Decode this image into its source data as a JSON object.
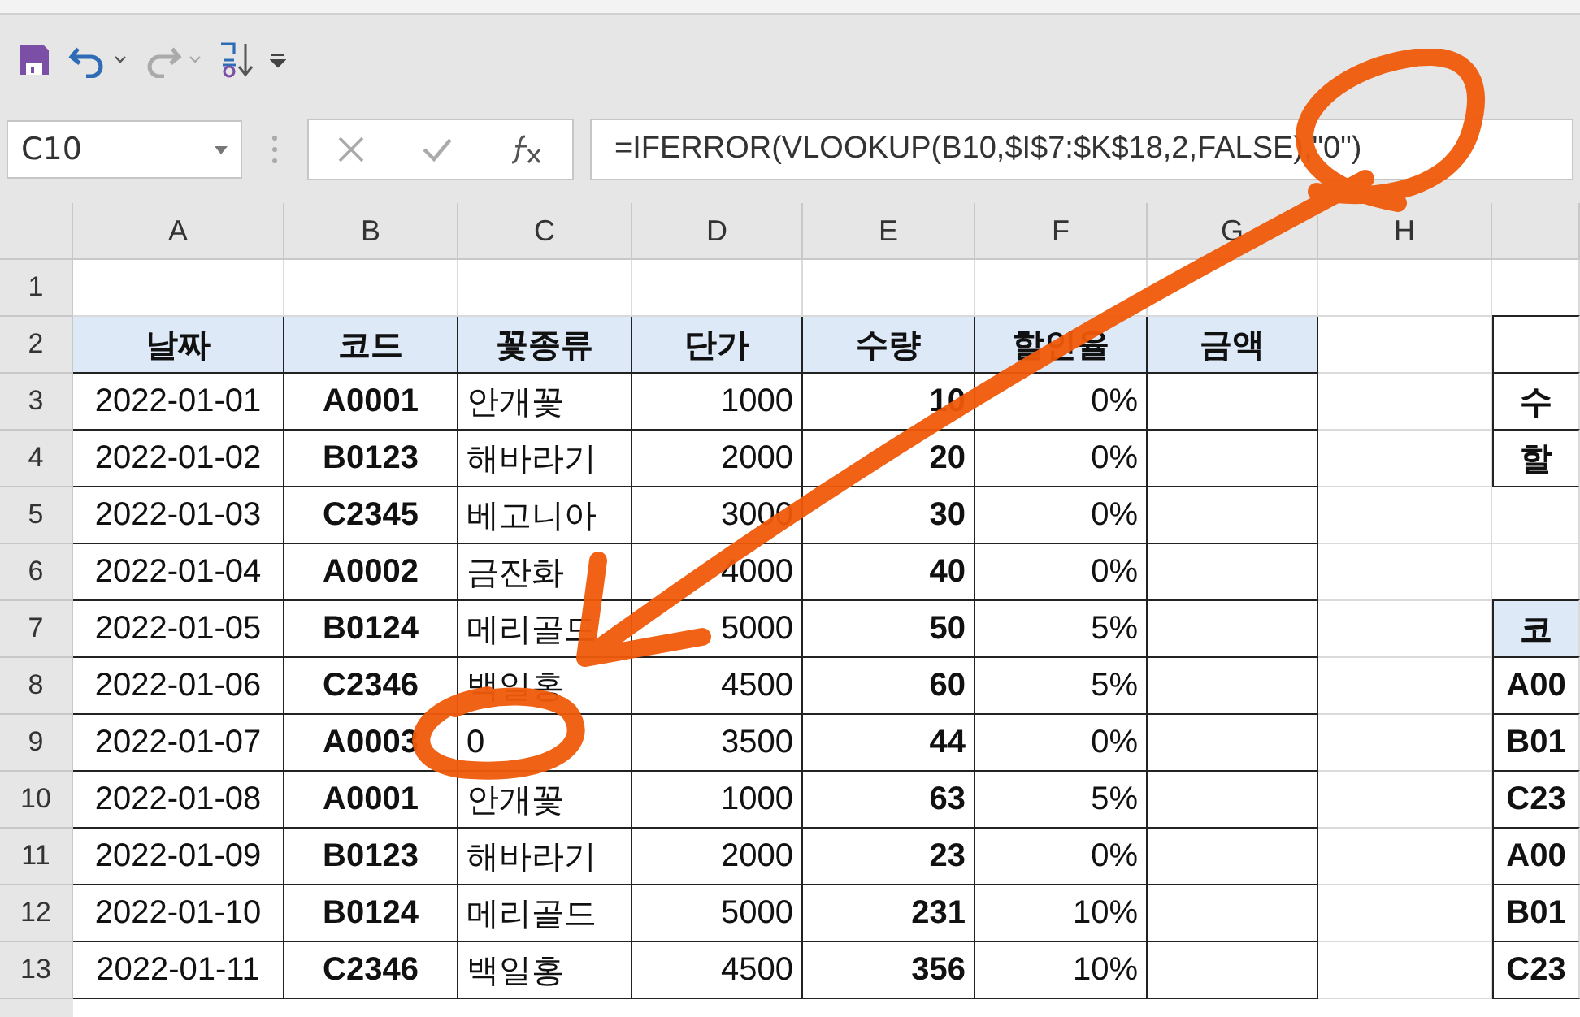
{
  "name_box": {
    "value": "C10"
  },
  "formula_bar": {
    "value": "=IFERROR(VLOOKUP(B10,$I$7:$K$18,2,FALSE),\"0\")"
  },
  "columns": [
    "A",
    "B",
    "C",
    "D",
    "E",
    "F",
    "G",
    "H"
  ],
  "first_row": {
    "number": "1"
  },
  "header_row": {
    "number": "2",
    "labels": [
      "날짜",
      "코드",
      "꽃종류",
      "단가",
      "수량",
      "할인율",
      "금액"
    ],
    "column_i": {
      "kind": "cell"
    }
  },
  "rows": [
    {
      "number": "3",
      "date": "2022-01-01",
      "code": "A0001",
      "flower": "안개꽃",
      "price": "1000",
      "qty": "10",
      "discount": "0%",
      "column_i": {
        "kind": "cell",
        "text": "수"
      }
    },
    {
      "number": "4",
      "date": "2022-01-02",
      "code": "B0123",
      "flower": "해바라기",
      "price": "2000",
      "qty": "20",
      "discount": "0%",
      "column_i": {
        "kind": "cell",
        "text": "할"
      }
    },
    {
      "number": "5",
      "date": "2022-01-03",
      "code": "C2345",
      "flower": "베고니아",
      "price": "3000",
      "qty": "30",
      "discount": "0%"
    },
    {
      "number": "6",
      "date": "2022-01-04",
      "code": "A0002",
      "flower": "금잔화",
      "price": "4000",
      "qty": "40",
      "discount": "0%"
    },
    {
      "number": "7",
      "date": "2022-01-05",
      "code": "B0124",
      "flower": "메리골드",
      "price": "5000",
      "qty": "50",
      "discount": "5%",
      "column_i": {
        "kind": "header",
        "text": "코"
      }
    },
    {
      "number": "8",
      "date": "2022-01-06",
      "code": "C2346",
      "flower": "백일홍",
      "price": "4500",
      "qty": "60",
      "discount": "5%",
      "column_i": {
        "kind": "cell",
        "text": "A00"
      }
    },
    {
      "number": "9",
      "date": "2022-01-07",
      "code": "A0003",
      "flower": "0",
      "price": "3500",
      "qty": "44",
      "discount": "0%",
      "column_i": {
        "kind": "cell",
        "text": "B01"
      }
    },
    {
      "number": "10",
      "date": "2022-01-08",
      "code": "A0001",
      "flower": "안개꽃",
      "price": "1000",
      "qty": "63",
      "discount": "5%",
      "column_i": {
        "kind": "cell",
        "text": "C23"
      }
    },
    {
      "number": "11",
      "date": "2022-01-09",
      "code": "B0123",
      "flower": "해바라기",
      "price": "2000",
      "qty": "23",
      "discount": "0%",
      "column_i": {
        "kind": "cell",
        "text": "A00"
      }
    },
    {
      "number": "12",
      "date": "2022-01-10",
      "code": "B0124",
      "flower": "메리골드",
      "price": "5000",
      "qty": "231",
      "discount": "10%",
      "column_i": {
        "kind": "cell",
        "text": "B01"
      }
    },
    {
      "number": "13",
      "date": "2022-01-11",
      "code": "C2346",
      "flower": "백일홍",
      "price": "4500",
      "qty": "356",
      "discount": "10%",
      "column_i": {
        "kind": "cell",
        "text": "C23"
      }
    }
  ]
}
